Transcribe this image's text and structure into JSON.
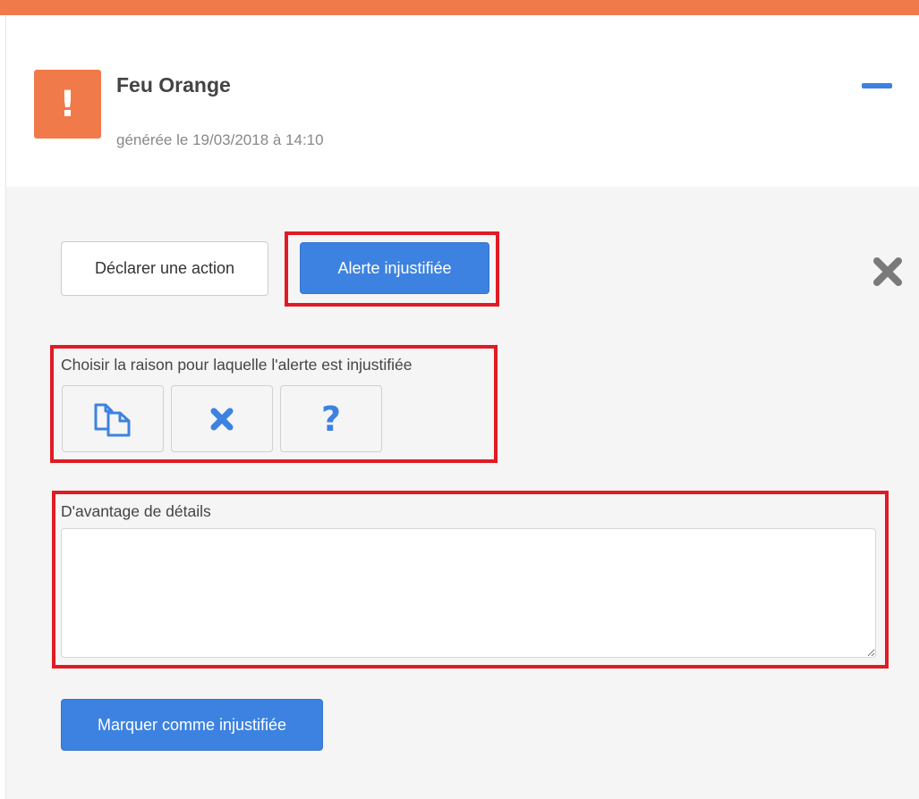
{
  "alert": {
    "badge_icon": "exclamation-icon",
    "badge_glyph": "!",
    "title": "Feu Orange",
    "subtitle": "générée le 19/03/2018 à 14:10",
    "accent_color": "#f07a4a"
  },
  "actions": {
    "declare_label": "Déclarer une action",
    "unjustified_label": "Alerte injustifiée",
    "primary_color": "#3d82e0"
  },
  "reason": {
    "label": "Choisir la raison pour laquelle l'alerte est injustifiée",
    "options": [
      {
        "icon": "duplicate-icon"
      },
      {
        "icon": "cross-icon"
      },
      {
        "icon": "question-icon",
        "glyph": "?"
      }
    ]
  },
  "details": {
    "label": "D'avantage de détails",
    "value": "",
    "placeholder": ""
  },
  "submit": {
    "label": "Marquer comme injustifiée"
  },
  "highlight_color": "#e01b24"
}
